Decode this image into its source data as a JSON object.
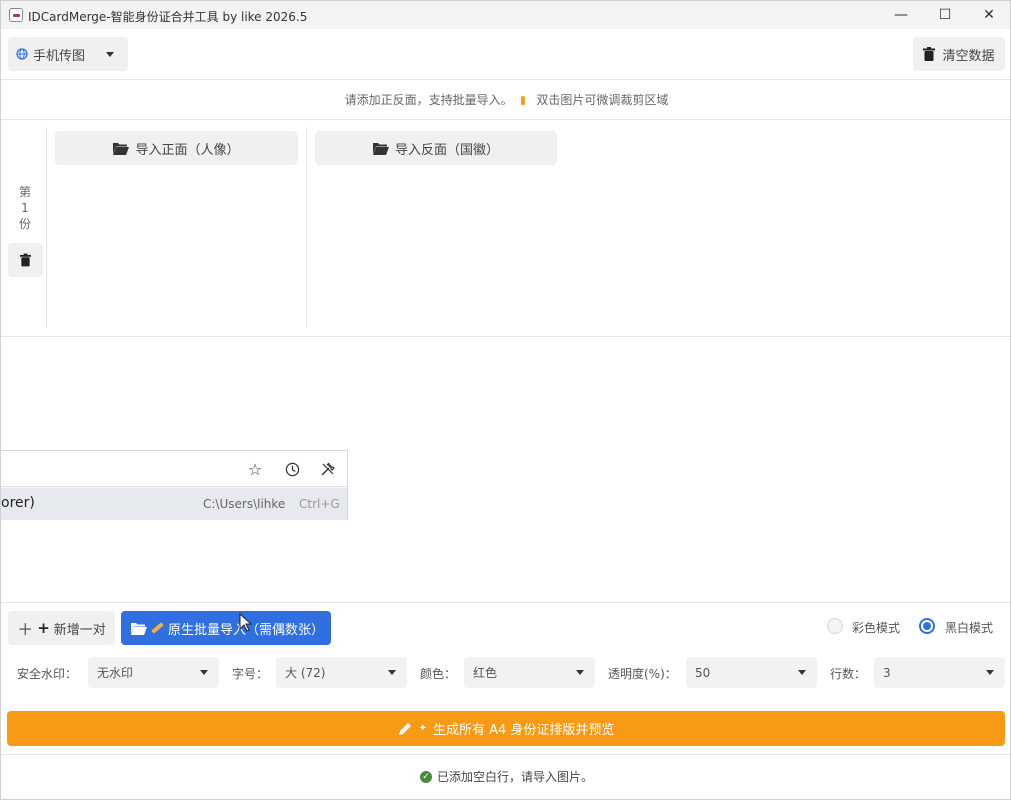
{
  "window": {
    "title": "IDCardMerge-智能身份证合并工具 by like 2026.5",
    "icon": "app-icon",
    "controls": {
      "minimize": "—",
      "maximize": "☐",
      "close": "✕"
    }
  },
  "toolbar": {
    "phone_upload_label": "手机传图",
    "clear_data_label": "清空数据"
  },
  "hint": {
    "text_before": "请添加正反面，支持批量导入。",
    "text_after": "双击图片可微调裁剪区域"
  },
  "card": {
    "label_chars": [
      "第",
      "1",
      "份"
    ],
    "import_front_label": "导入正面（人像）",
    "import_back_label": "导入反面（国徽）"
  },
  "popup": {
    "row_left_text": "orer)",
    "row_path": "C:\\Users\\lihke",
    "row_shortcut": "Ctrl+G"
  },
  "bottom": {
    "add_pair_label": "新增一对",
    "batch_import_label": "原生批量导入（需偶数张）",
    "color_mode_label": "彩色模式",
    "bw_mode_label": "黑白模式",
    "selected_mode": "黑白模式",
    "watermark_label": "安全水印：",
    "watermark_value": "无水印",
    "font_size_label": "字号：",
    "font_size_value": "大 (72)",
    "color_label": "颜色：",
    "color_value": "红色",
    "opacity_label": "透明度(%)：",
    "opacity_value": "50",
    "rows_label": "行数：",
    "rows_value": "3",
    "generate_label": "生成所有 A4 身份证排版并预览"
  },
  "status": {
    "text": "已添加空白行，请导入图片。"
  },
  "colors": {
    "accent_blue": "#2f6fe0",
    "accent_orange": "#f79b16",
    "status_green": "#4a8a3c"
  }
}
